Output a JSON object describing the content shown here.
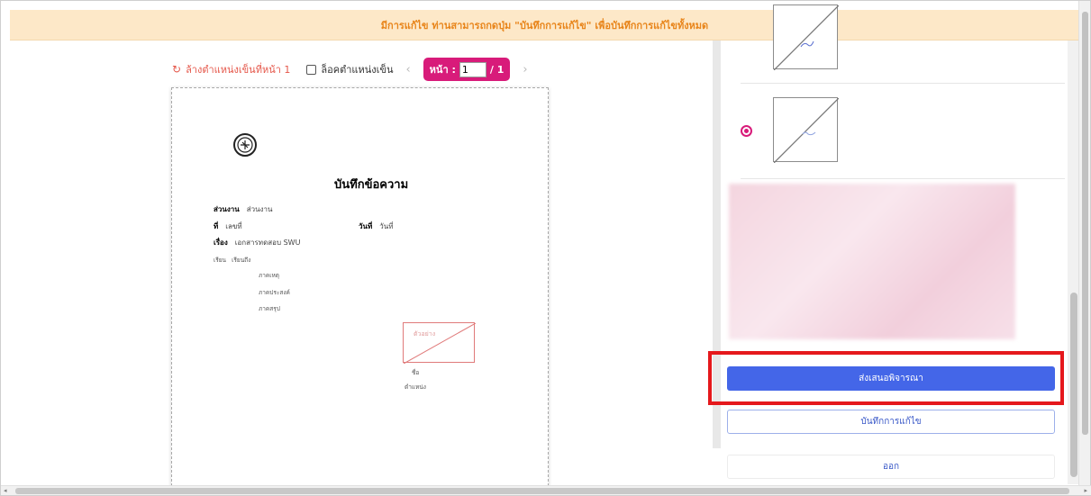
{
  "banner": {
    "message": "มีการแก้ไข ท่านสามารถกดปุ่ม \"บันทึกการแก้ไข\" เพื่อบันทึกการแก้ไขทั้งหมด"
  },
  "toolbar": {
    "clear_icon": "refresh-icon",
    "clear_label": "ล้างตำแหน่งเข็นที่หน้า 1",
    "lock_label": "ล็อคตำแหน่งเข็น",
    "page_label": "หน้า :",
    "page_value": "1",
    "page_total": "/ 1"
  },
  "document": {
    "title": "บันทึกข้อความ",
    "dept_label": "ส่วนงาน",
    "dept_value": "ส่วนงาน",
    "no_label": "ที่",
    "no_value": "เลขที่",
    "date_label": "วันที่",
    "date_value": "วันที่",
    "subject_label": "เรื่อง",
    "subject_value": "เอกสารทดสอบ SWU",
    "to_label": "เรียน",
    "to_value": "เรียนถึง",
    "para1": "ภาคเหตุ",
    "para2": "ภาคประสงค์",
    "para3": "ภาคสรุป",
    "sign_box_label": "ตัวอย่าง",
    "signer_name": "ชื่อ",
    "signer_position": "ตำแหน่ง"
  },
  "panel": {
    "submit_label": "ส่งเสนอพิจารณา",
    "save_label": "บันทึกการแก้ไข",
    "exit_label": "ออก"
  },
  "colors": {
    "accent": "#d81b7a",
    "primary": "#4466e8",
    "banner_bg": "#fde8c8",
    "banner_text": "#e8851b",
    "highlight": "#e5181c"
  }
}
